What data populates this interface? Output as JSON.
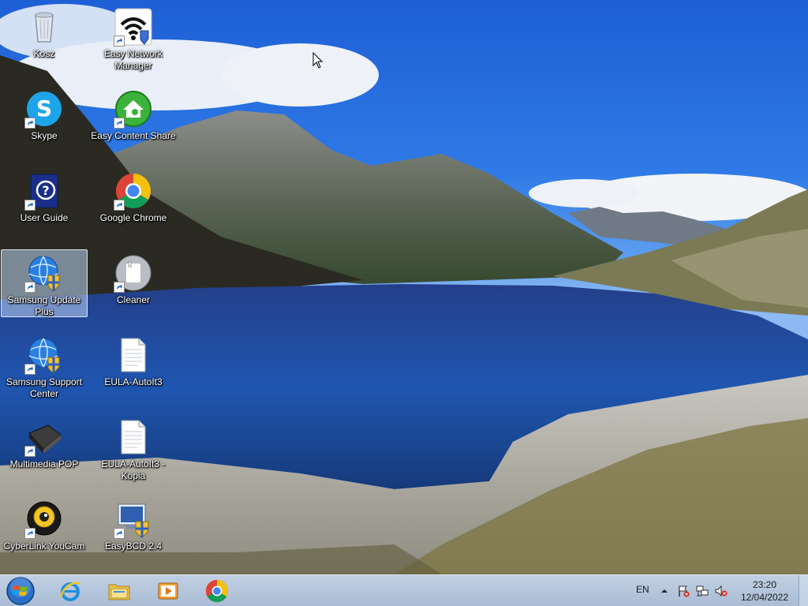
{
  "desktop": {
    "icons": [
      {
        "label": "Kosz",
        "icon": "recycle-bin-icon",
        "shortcut": false,
        "selected": false
      },
      {
        "label": "Easy Network Manager",
        "icon": "wifi-icon",
        "shortcut": true,
        "selected": false
      },
      {
        "label": "Skype",
        "icon": "skype-icon",
        "shortcut": true,
        "selected": false
      },
      {
        "label": "Easy Content Share",
        "icon": "content-share-icon",
        "shortcut": true,
        "selected": false
      },
      {
        "label": "User Guide",
        "icon": "help-book-icon",
        "shortcut": true,
        "selected": false
      },
      {
        "label": "Google Chrome",
        "icon": "chrome-icon",
        "shortcut": true,
        "selected": false
      },
      {
        "label": "Samsung Update Plus",
        "icon": "globe-shield-icon",
        "shortcut": true,
        "selected": true
      },
      {
        "label": "Cleaner",
        "icon": "cleaner-icon",
        "shortcut": true,
        "selected": false
      },
      {
        "label": "Samsung Support Center",
        "icon": "globe-shield-icon",
        "shortcut": true,
        "selected": false
      },
      {
        "label": "EULA-AutoIt3",
        "icon": "text-document-icon",
        "shortcut": false,
        "selected": false
      },
      {
        "label": "Multimedia POP",
        "icon": "multimedia-icon",
        "shortcut": true,
        "selected": false
      },
      {
        "label": "EULA-AutoIt3 - Kopia",
        "icon": "text-document-icon",
        "shortcut": false,
        "selected": false
      },
      {
        "label": "CyberLink YouCam",
        "icon": "webcam-icon",
        "shortcut": true,
        "selected": false
      },
      {
        "label": "EasyBCD 2.4",
        "icon": "easybcd-icon",
        "shortcut": true,
        "selected": false
      }
    ]
  },
  "taskbar": {
    "start": {
      "icon": "windows-start-icon"
    },
    "pinned": [
      {
        "icon": "internet-explorer-icon"
      },
      {
        "icon": "file-explorer-icon"
      },
      {
        "icon": "media-player-icon"
      },
      {
        "icon": "chrome-icon"
      }
    ],
    "tray": {
      "language": "EN",
      "icons": [
        "show-hidden-icons-arrow",
        "action-center-flag-icon",
        "network-icon",
        "volume-muted-icon"
      ],
      "time": "23:20",
      "date": "12/04/2022"
    }
  },
  "colors": {
    "sky": "#2f7ae6",
    "lake": "#1f4a9c",
    "taskbar": "#b5c6dc"
  }
}
